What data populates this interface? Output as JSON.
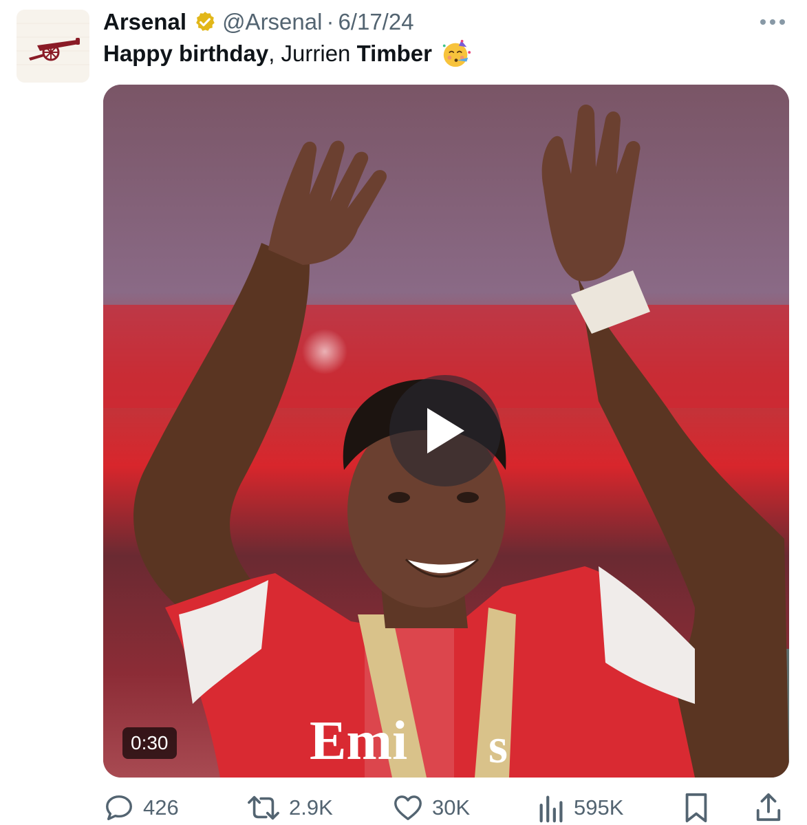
{
  "account": {
    "display_name": "Arsenal",
    "handle": "@Arsenal",
    "separator": "·",
    "date": "6/17/24",
    "verified_icon": "verified-gold-badge-icon",
    "avatar_icon": "arsenal-cannon-icon"
  },
  "tweet": {
    "text_part1": "Happy birthday",
    "text_part2": ", Jurrien ",
    "text_part3": "Timber",
    "emoji_icon": "partying-face-emoji"
  },
  "media": {
    "type": "video",
    "duration": "0:30",
    "play_icon": "play-icon"
  },
  "actions": {
    "replies": "426",
    "reposts": "2.9K",
    "likes": "30K",
    "views": "595K",
    "reply_icon": "reply-icon",
    "repost_icon": "repost-icon",
    "like_icon": "heart-icon",
    "views_icon": "views-chart-icon",
    "bookmark_icon": "bookmark-icon",
    "share_icon": "share-icon"
  },
  "colors": {
    "text_primary": "#0f1419",
    "text_secondary": "#536471",
    "verified_gold": "#e2b719",
    "arsenal_red": "#9c1c28"
  }
}
